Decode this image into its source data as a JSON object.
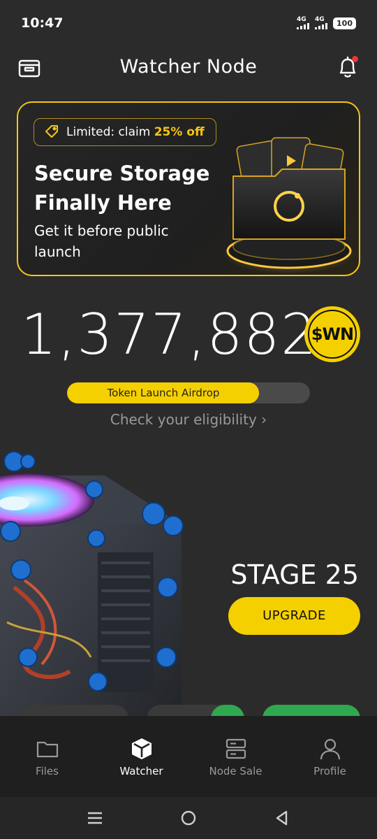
{
  "status": {
    "time": "10:47",
    "network1": "4G",
    "network2": "4G",
    "battery": "100"
  },
  "header": {
    "title": "Watcher Node"
  },
  "promo": {
    "badge_text": "Limited: claim ",
    "badge_highlight": "25% off",
    "title": "Secure Storage Finally Here",
    "subtitle": "Get it before public launch"
  },
  "balance": {
    "amount": "1,377,882",
    "token": "$WN"
  },
  "airdrop": {
    "label": "Token Launch Airdrop",
    "progress": 0.79,
    "link": "Check your eligibility"
  },
  "node": {
    "stage": "STAGE 25",
    "upgrade_label": "UPGRADE"
  },
  "nav": {
    "items": [
      {
        "label": "Files",
        "icon": "folder-icon",
        "active": false
      },
      {
        "label": "Watcher",
        "icon": "cube-icon",
        "active": true
      },
      {
        "label": "Node Sale",
        "icon": "server-icon",
        "active": false
      },
      {
        "label": "Profile",
        "icon": "user-icon",
        "active": false
      }
    ]
  },
  "colors": {
    "accent": "#f5d000",
    "background": "#2b2b2b",
    "nav_background": "#1f1f1f",
    "notification_dot": "#e53935"
  }
}
